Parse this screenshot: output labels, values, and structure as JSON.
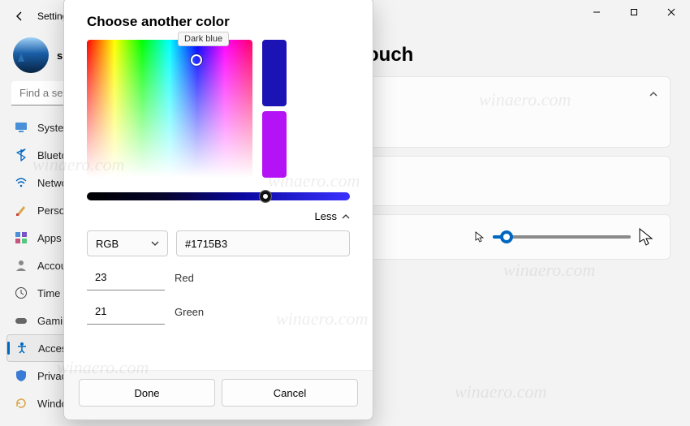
{
  "window": {
    "back": "←",
    "title": "Settings",
    "controls": {
      "min": "—",
      "max": "▢",
      "close": "✕"
    }
  },
  "profile": {
    "initial": "s"
  },
  "search": {
    "placeholder": "Find a setting"
  },
  "nav": {
    "items": [
      {
        "icon": "system",
        "label": "System"
      },
      {
        "icon": "bluetooth",
        "label": "Bluetooth & devices"
      },
      {
        "icon": "network",
        "label": "Network & internet"
      },
      {
        "icon": "personalization",
        "label": "Personalization"
      },
      {
        "icon": "apps",
        "label": "Apps"
      },
      {
        "icon": "accounts",
        "label": "Accounts"
      },
      {
        "icon": "time",
        "label": "Time & language"
      },
      {
        "icon": "gaming",
        "label": "Gaming"
      },
      {
        "icon": "accessibility",
        "label": "Accessibility"
      },
      {
        "icon": "privacy",
        "label": "Privacy & security"
      },
      {
        "icon": "update",
        "label": "Windows Update"
      }
    ]
  },
  "page": {
    "title": "Mouse pointer and touch"
  },
  "pointer": {
    "swatches": [
      "#0099cc",
      "#00c490"
    ]
  },
  "modal": {
    "title": "Choose another color",
    "tooltip": "Dark blue",
    "less": "Less",
    "mode": "RGB",
    "hex": "#1715B3",
    "r": "23",
    "r_label": "Red",
    "g": "21",
    "g_label": "Green",
    "done": "Done",
    "cancel": "Cancel",
    "preview_old": "#1c13b5",
    "preview_new": "#b413f5"
  },
  "watermark": "winaero.com"
}
